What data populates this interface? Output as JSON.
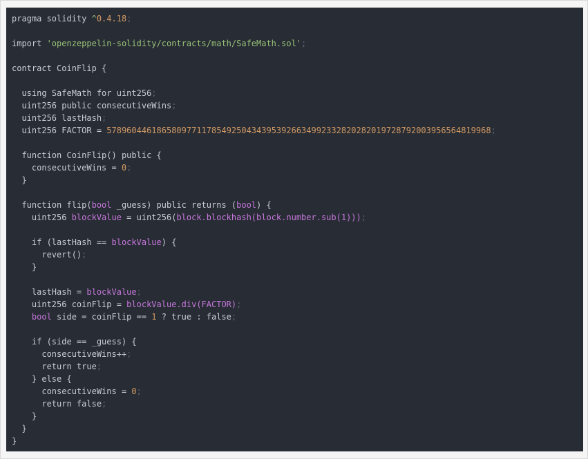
{
  "colors": {
    "panel_background": "#282c34",
    "plain": "#c8ccd4",
    "string": "#98c379",
    "number": "#d19a66",
    "keyword": "#c678dd",
    "punctuation": "#5c6370"
  },
  "code": {
    "language": "solidity",
    "lines": [
      [
        {
          "t": "text",
          "v": "pragma solidity "
        },
        {
          "t": "str",
          "v": "^"
        },
        {
          "t": "num",
          "v": "0.4.18"
        },
        {
          "t": "punc",
          "v": ";"
        }
      ],
      [],
      [
        {
          "t": "text",
          "v": "import "
        },
        {
          "t": "str",
          "v": "'openzeppelin-solidity/contracts/math/SafeMath.sol'"
        },
        {
          "t": "punc",
          "v": ";"
        }
      ],
      [],
      [
        {
          "t": "text",
          "v": "contract CoinFlip {"
        }
      ],
      [],
      [
        {
          "t": "text",
          "v": "  using SafeMath for uint256"
        },
        {
          "t": "punc",
          "v": ";"
        }
      ],
      [
        {
          "t": "text",
          "v": "  uint256 public consecutiveWins"
        },
        {
          "t": "punc",
          "v": ";"
        }
      ],
      [
        {
          "t": "text",
          "v": "  uint256 lastHash"
        },
        {
          "t": "punc",
          "v": ";"
        }
      ],
      [
        {
          "t": "text",
          "v": "  uint256 FACTOR = "
        },
        {
          "t": "num",
          "v": "57896044618658097711785492504343953926634992332820282019728792003956564819968"
        },
        {
          "t": "punc",
          "v": ";"
        }
      ],
      [],
      [
        {
          "t": "text",
          "v": "  function CoinFlip() public {"
        }
      ],
      [
        {
          "t": "text",
          "v": "    consecutiveWins = "
        },
        {
          "t": "num",
          "v": "0"
        },
        {
          "t": "punc",
          "v": ";"
        }
      ],
      [
        {
          "t": "text",
          "v": "  }"
        }
      ],
      [],
      [
        {
          "t": "text",
          "v": "  function flip("
        },
        {
          "t": "kw",
          "v": "bool"
        },
        {
          "t": "text",
          "v": " _guess) public returns ("
        },
        {
          "t": "kw",
          "v": "bool"
        },
        {
          "t": "text",
          "v": ") {"
        }
      ],
      [
        {
          "t": "text",
          "v": "    uint256 "
        },
        {
          "t": "kw",
          "v": "blockValue"
        },
        {
          "t": "text",
          "v": " = uint256("
        },
        {
          "t": "kw",
          "v": "block.blockhash(block.number.sub(1)))"
        },
        {
          "t": "punc",
          "v": ";"
        }
      ],
      [],
      [
        {
          "t": "text",
          "v": "    if (lastHash == "
        },
        {
          "t": "kw",
          "v": "blockValue"
        },
        {
          "t": "text",
          "v": ") {"
        }
      ],
      [
        {
          "t": "text",
          "v": "      revert()"
        },
        {
          "t": "punc",
          "v": ";"
        }
      ],
      [
        {
          "t": "text",
          "v": "    }"
        }
      ],
      [],
      [
        {
          "t": "text",
          "v": "    lastHash = "
        },
        {
          "t": "kw",
          "v": "blockValue"
        },
        {
          "t": "punc",
          "v": ";"
        }
      ],
      [
        {
          "t": "text",
          "v": "    uint256 coinFlip = "
        },
        {
          "t": "kw",
          "v": "blockValue.div(FACTOR)"
        },
        {
          "t": "punc",
          "v": ";"
        }
      ],
      [
        {
          "t": "kw",
          "v": "    bool"
        },
        {
          "t": "text",
          "v": " side = coinFlip == "
        },
        {
          "t": "num",
          "v": "1"
        },
        {
          "t": "text",
          "v": " ? true : false"
        },
        {
          "t": "punc",
          "v": ";"
        }
      ],
      [],
      [
        {
          "t": "text",
          "v": "    if (side == _guess) {"
        }
      ],
      [
        {
          "t": "text",
          "v": "      consecutiveWins++"
        },
        {
          "t": "punc",
          "v": ";"
        }
      ],
      [
        {
          "t": "text",
          "v": "      return true"
        },
        {
          "t": "punc",
          "v": ";"
        }
      ],
      [
        {
          "t": "text",
          "v": "    } else {"
        }
      ],
      [
        {
          "t": "text",
          "v": "      consecutiveWins = "
        },
        {
          "t": "num",
          "v": "0"
        },
        {
          "t": "punc",
          "v": ";"
        }
      ],
      [
        {
          "t": "text",
          "v": "      return false"
        },
        {
          "t": "punc",
          "v": ";"
        }
      ],
      [
        {
          "t": "text",
          "v": "    }"
        }
      ],
      [
        {
          "t": "text",
          "v": "  }"
        }
      ],
      [
        {
          "t": "text",
          "v": "}"
        }
      ]
    ]
  }
}
